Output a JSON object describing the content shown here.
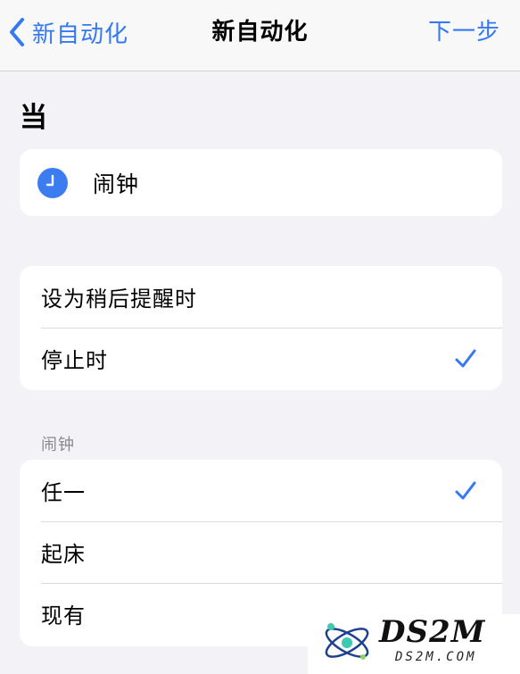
{
  "navbar": {
    "back_label": "新自动化",
    "title": "新自动化",
    "next_label": "下一步"
  },
  "when_header": "当",
  "trigger": {
    "icon": "clock-icon",
    "label": "闹钟"
  },
  "timing_options": [
    {
      "label": "设为稍后提醒时",
      "checked": false
    },
    {
      "label": "停止时",
      "checked": true
    }
  ],
  "alarm_section_header": "闹钟",
  "alarm_options": [
    {
      "label": "任一",
      "checked": true
    },
    {
      "label": "起床",
      "checked": false
    },
    {
      "label": "现有",
      "checked": false
    }
  ],
  "watermark": {
    "text": "DS2M",
    "sub": "DS2M.COM"
  },
  "colors": {
    "accent": "#3478f6",
    "background": "#f2f2f7",
    "card": "#ffffff",
    "secondary_text": "#8a8a8e"
  }
}
